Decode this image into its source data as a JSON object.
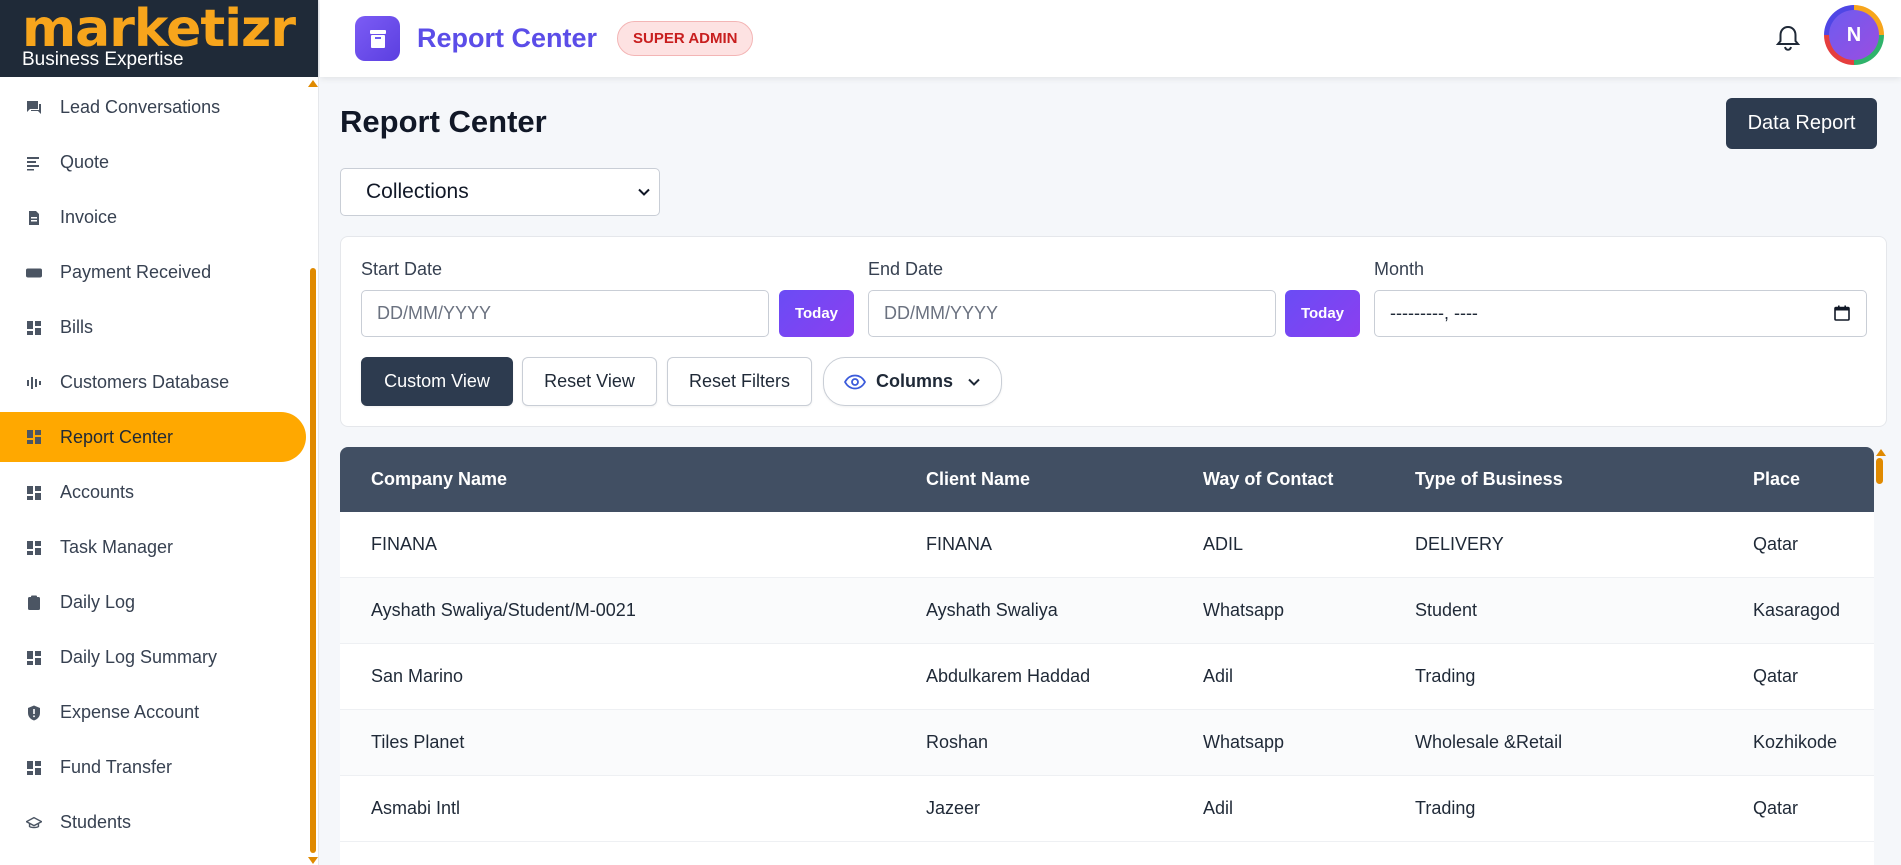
{
  "brand": {
    "name": "marketizr",
    "tagline": "Business Expertise"
  },
  "sidebar": {
    "items": [
      {
        "label": "Lead Conversations",
        "icon": "chat-icon"
      },
      {
        "label": "Quote",
        "icon": "list-icon"
      },
      {
        "label": "Invoice",
        "icon": "document-icon"
      },
      {
        "label": "Payment Received",
        "icon": "card-icon"
      },
      {
        "label": "Bills",
        "icon": "grid-icon"
      },
      {
        "label": "Customers Database",
        "icon": "bars-icon"
      },
      {
        "label": "Report Center",
        "icon": "grid-icon",
        "active": true
      },
      {
        "label": "Accounts",
        "icon": "grid-icon"
      },
      {
        "label": "Task Manager",
        "icon": "grid-icon"
      },
      {
        "label": "Daily Log",
        "icon": "clipboard-icon"
      },
      {
        "label": "Daily Log Summary",
        "icon": "grid-icon"
      },
      {
        "label": "Expense Account",
        "icon": "shield-icon"
      },
      {
        "label": "Fund Transfer",
        "icon": "grid-icon"
      },
      {
        "label": "Students",
        "icon": "graduation-cap-icon"
      }
    ]
  },
  "header": {
    "title": "Report Center",
    "role_badge": "SUPER ADMIN",
    "avatar_initial": "N"
  },
  "main": {
    "page_title": "Report Center",
    "data_report_label": "Data Report",
    "report_select": {
      "value": "Collections"
    },
    "filters": {
      "start_date_label": "Start Date",
      "start_date_placeholder": "DD/MM/YYYY",
      "end_date_label": "End Date",
      "end_date_placeholder": "DD/MM/YYYY",
      "month_label": "Month",
      "month_value": "---------, ----",
      "today_label": "Today",
      "custom_view_label": "Custom View",
      "reset_view_label": "Reset View",
      "reset_filters_label": "Reset Filters",
      "columns_label": "Columns"
    },
    "table": {
      "headers": [
        "Company Name",
        "Client Name",
        "Way of Contact",
        "Type of Business",
        "Place"
      ],
      "rows": [
        [
          "FINANA",
          "FINANA",
          "ADIL",
          "DELIVERY",
          "Qatar"
        ],
        [
          "Ayshath Swaliya/Student/M-0021",
          "Ayshath Swaliya",
          "Whatsapp",
          "Student",
          "Kasaragod"
        ],
        [
          "San Marino",
          "Abdulkarem Haddad",
          "Adil",
          "Trading",
          "Qatar"
        ],
        [
          "Tiles Planet",
          "Roshan",
          "Whatsapp",
          "Wholesale &Retail",
          "Kozhikode"
        ],
        [
          "Asmabi Intl",
          "Jazeer",
          "Adil",
          "Trading",
          "Qatar"
        ]
      ]
    }
  },
  "colors": {
    "accent": "#ffa800",
    "brand_purple": "#5b4de8",
    "dark": "#2d3b4f",
    "table_header": "#414f63"
  }
}
